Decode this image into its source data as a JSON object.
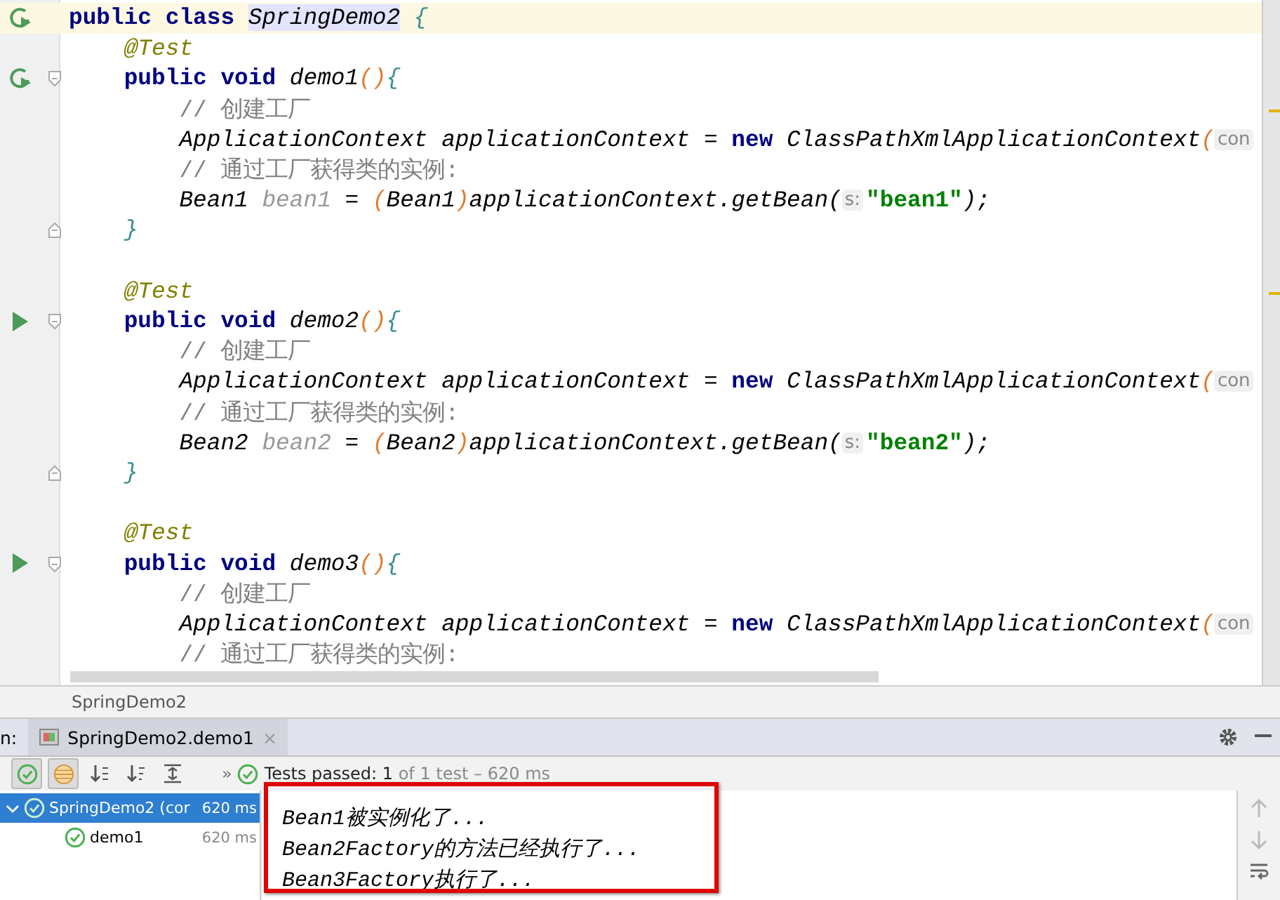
{
  "editor": {
    "lines": [
      {
        "gutter": {
          "kind": "rerun"
        },
        "current": true,
        "tokens": [
          {
            "text": "public class ",
            "kind": "keyword"
          },
          {
            "text": "SpringDemo2",
            "kind": "class-highlight"
          },
          {
            "text": " {",
            "kind": "brace"
          }
        ]
      },
      {
        "current": false,
        "tokens": [
          {
            "text": "    @Test",
            "kind": "annotation"
          }
        ]
      },
      {
        "gutter": {
          "kind": "rerun"
        },
        "fold": {
          "kind": "open"
        },
        "current": false,
        "tokens": [
          {
            "text": "    public void ",
            "kind": "keyword"
          },
          {
            "text": "demo1",
            "kind": "italic"
          },
          {
            "text": "()",
            "kind": "paren"
          },
          {
            "text": "{",
            "kind": "brace"
          }
        ]
      },
      {
        "current": false,
        "tokens": [
          {
            "text": "        // 创建工厂",
            "kind": "comment"
          }
        ]
      },
      {
        "current": false,
        "tokens": [
          {
            "text": "        ApplicationContext applicationContext = ",
            "kind": "italic"
          },
          {
            "text": "new ",
            "kind": "keyword"
          },
          {
            "text": "ClassPathXmlApplicationContext",
            "kind": "italic"
          },
          {
            "text": "(",
            "kind": "paren"
          },
          {
            "text": "con",
            "kind": "hint"
          }
        ]
      },
      {
        "current": false,
        "tokens": [
          {
            "text": "        // 通过工厂获得类的实例:",
            "kind": "comment"
          }
        ]
      },
      {
        "current": false,
        "tokens": [
          {
            "text": "        Bean1 ",
            "kind": "italic"
          },
          {
            "text": "bean1",
            "kind": "unused"
          },
          {
            "text": " = ",
            "kind": "italic"
          },
          {
            "text": "(",
            "kind": "paren"
          },
          {
            "text": "Bean1",
            "kind": "italic"
          },
          {
            "text": ")",
            "kind": "paren"
          },
          {
            "text": "applicationContext.getBean(",
            "kind": "italic"
          },
          {
            "text": "s:",
            "kind": "hint"
          },
          {
            "text": "\"bean1\"",
            "kind": "string"
          },
          {
            "text": ");",
            "kind": "italic"
          }
        ]
      },
      {
        "fold": {
          "kind": "close"
        },
        "current": false,
        "tokens": [
          {
            "text": "    }",
            "kind": "brace"
          }
        ]
      },
      {
        "current": false
      },
      {
        "current": false,
        "tokens": [
          {
            "text": "    @Test",
            "kind": "annotation"
          }
        ]
      },
      {
        "gutter": {
          "kind": "run"
        },
        "fold": {
          "kind": "open"
        },
        "current": false,
        "tokens": [
          {
            "text": "    public void ",
            "kind": "keyword"
          },
          {
            "text": "demo2",
            "kind": "italic"
          },
          {
            "text": "()",
            "kind": "paren"
          },
          {
            "text": "{",
            "kind": "brace"
          }
        ]
      },
      {
        "current": false,
        "tokens": [
          {
            "text": "        // 创建工厂",
            "kind": "comment"
          }
        ]
      },
      {
        "current": false,
        "tokens": [
          {
            "text": "        ApplicationContext applicationContext = ",
            "kind": "italic"
          },
          {
            "text": "new ",
            "kind": "keyword"
          },
          {
            "text": "ClassPathXmlApplicationContext",
            "kind": "italic"
          },
          {
            "text": "(",
            "kind": "paren"
          },
          {
            "text": "con",
            "kind": "hint"
          }
        ]
      },
      {
        "current": false,
        "tokens": [
          {
            "text": "        // 通过工厂获得类的实例:",
            "kind": "comment"
          }
        ]
      },
      {
        "current": false,
        "tokens": [
          {
            "text": "        Bean2 ",
            "kind": "italic"
          },
          {
            "text": "bean2",
            "kind": "unused"
          },
          {
            "text": " = ",
            "kind": "italic"
          },
          {
            "text": "(",
            "kind": "paren"
          },
          {
            "text": "Bean2",
            "kind": "italic"
          },
          {
            "text": ")",
            "kind": "paren"
          },
          {
            "text": "applicationContext.getBean(",
            "kind": "italic"
          },
          {
            "text": "s:",
            "kind": "hint"
          },
          {
            "text": "\"bean2\"",
            "kind": "string"
          },
          {
            "text": ");",
            "kind": "italic"
          }
        ]
      },
      {
        "fold": {
          "kind": "close"
        },
        "current": false,
        "tokens": [
          {
            "text": "    }",
            "kind": "brace"
          }
        ]
      },
      {
        "current": false
      },
      {
        "current": false,
        "tokens": [
          {
            "text": "    @Test",
            "kind": "annotation"
          }
        ]
      },
      {
        "gutter": {
          "kind": "run"
        },
        "fold": {
          "kind": "open"
        },
        "current": false,
        "tokens": [
          {
            "text": "    public void ",
            "kind": "keyword"
          },
          {
            "text": "demo3",
            "kind": "italic"
          },
          {
            "text": "()",
            "kind": "paren"
          },
          {
            "text": "{",
            "kind": "brace"
          }
        ]
      },
      {
        "current": false,
        "tokens": [
          {
            "text": "        // 创建工厂",
            "kind": "comment"
          }
        ]
      },
      {
        "current": false,
        "tokens": [
          {
            "text": "        ApplicationContext applicationContext = ",
            "kind": "italic"
          },
          {
            "text": "new ",
            "kind": "keyword"
          },
          {
            "text": "ClassPathXmlApplicationContext",
            "kind": "italic"
          },
          {
            "text": "(",
            "kind": "paren"
          },
          {
            "text": "con",
            "kind": "hint"
          }
        ]
      },
      {
        "current": false,
        "tokens": [
          {
            "text": "        // 通过工厂获得类的实例:",
            "kind": "comment"
          }
        ]
      }
    ]
  },
  "breadcrumb": "SpringDemo2",
  "run_panel": {
    "label": "n:",
    "tab": {
      "title": "SpringDemo2.demo1",
      "close": "×",
      "selected": true
    },
    "more": "»",
    "status": {
      "bold": "Tests passed: 1",
      "rest": "of 1 test – 620 ms"
    },
    "tree": [
      {
        "name": "SpringDemo2 (cor",
        "time": "620 ms",
        "selected": true,
        "expanded": true,
        "children": [
          {
            "name": "demo1",
            "time": "620 ms",
            "selected": false
          }
        ]
      }
    ],
    "console": [
      "Bean1被实例化了...",
      "Bean2Factory的方法已经执行了...",
      "Bean3Factory执行了..."
    ]
  }
}
